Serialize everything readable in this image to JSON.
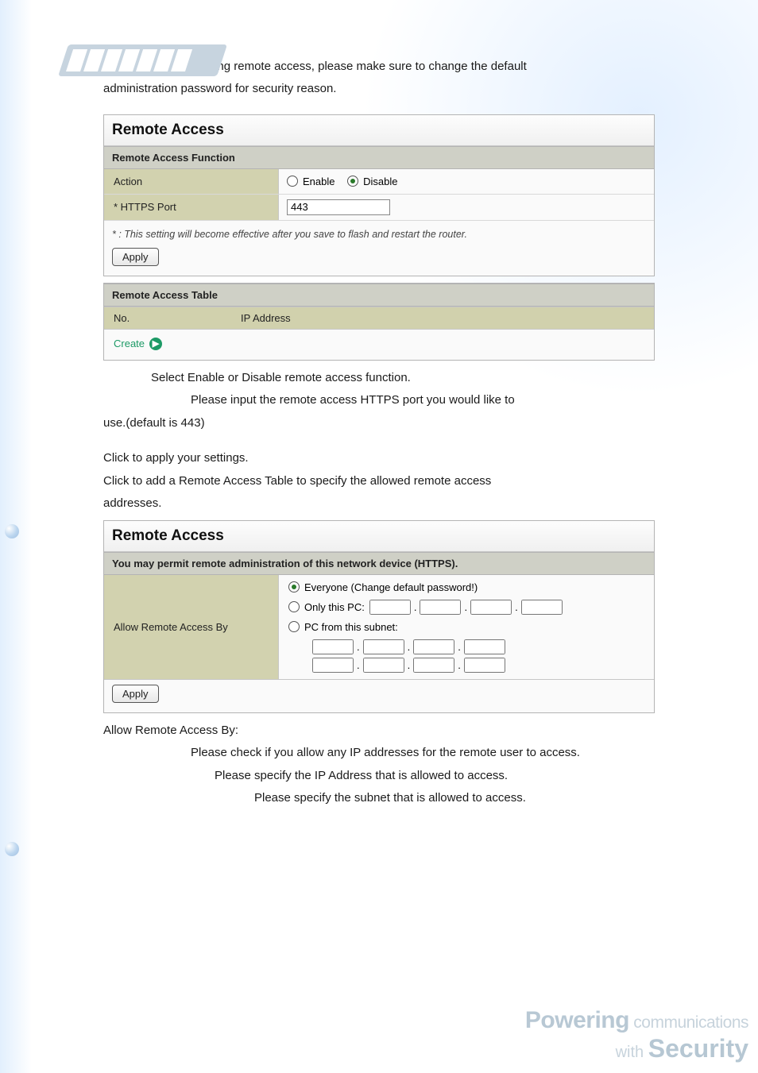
{
  "intro": {
    "line1": "When enabling remote access, please make sure to change the default",
    "line2": "administration password for security reason."
  },
  "panel1": {
    "title": "Remote Access",
    "section1": "Remote Access Function",
    "action_label": "Action",
    "enable_label": "Enable",
    "disable_label": "Disable",
    "https_label": "* HTTPS Port",
    "https_value": "443",
    "note": "* : This setting will become effective after you save to flash and restart the router.",
    "apply": "Apply",
    "table_section": "Remote Access Table",
    "col_no": "No.",
    "col_ip": "IP Address",
    "create": "Create"
  },
  "mid": {
    "l1": "Select Enable or Disable remote access function.",
    "l2": "Please input the remote access HTTPS port you would like to",
    "l3": "use.(default is 443)",
    "l4": "Click           to apply your settings.",
    "l5": "Click             to add a Remote Access Table to specify the allowed remote access",
    "l6": "addresses."
  },
  "panel2": {
    "title": "Remote Access",
    "subhead": "You may permit remote administration of this network device (HTTPS).",
    "allow_label": "Allow Remote Access By",
    "opt_everyone": "Everyone (Change default password!)",
    "opt_only": "Only this PC:",
    "opt_subnet": "PC from this subnet:",
    "apply": "Apply"
  },
  "post": {
    "h": "Allow Remote Access By:",
    "p1": "Please check if you allow any IP addresses for the remote user to access.",
    "p2": "Please specify the IP Address that is allowed to access.",
    "p3": "Please specify the subnet that is allowed to access."
  },
  "footer": {
    "powering": "Powering",
    "comm": " communications",
    "with": "with ",
    "sec": "Security"
  }
}
